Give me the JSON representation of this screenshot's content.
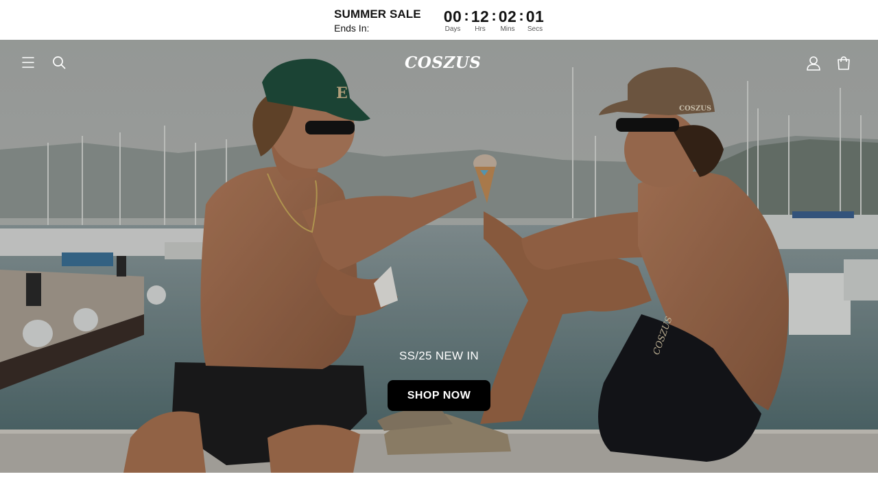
{
  "announcement": {
    "title": "SUMMER SALE",
    "subtitle": "Ends In:",
    "countdown": [
      {
        "value": "00",
        "label": "Days"
      },
      {
        "value": "12",
        "label": "Hrs"
      },
      {
        "value": "02",
        "label": "Mins"
      },
      {
        "value": "01",
        "label": "Secs"
      }
    ],
    "separator": ":"
  },
  "header": {
    "logo": "COSZUS",
    "icons": [
      "menu-icon",
      "search-icon",
      "account-icon",
      "cart-icon"
    ]
  },
  "hero": {
    "caption": "SS/25 NEW IN",
    "cta_label": "SHOP NOW"
  },
  "colors": {
    "cta_background": "#000000",
    "text_on_hero": "#ffffff",
    "cap_green": "#1f4d3c",
    "cap_tan": "#7a6048"
  }
}
